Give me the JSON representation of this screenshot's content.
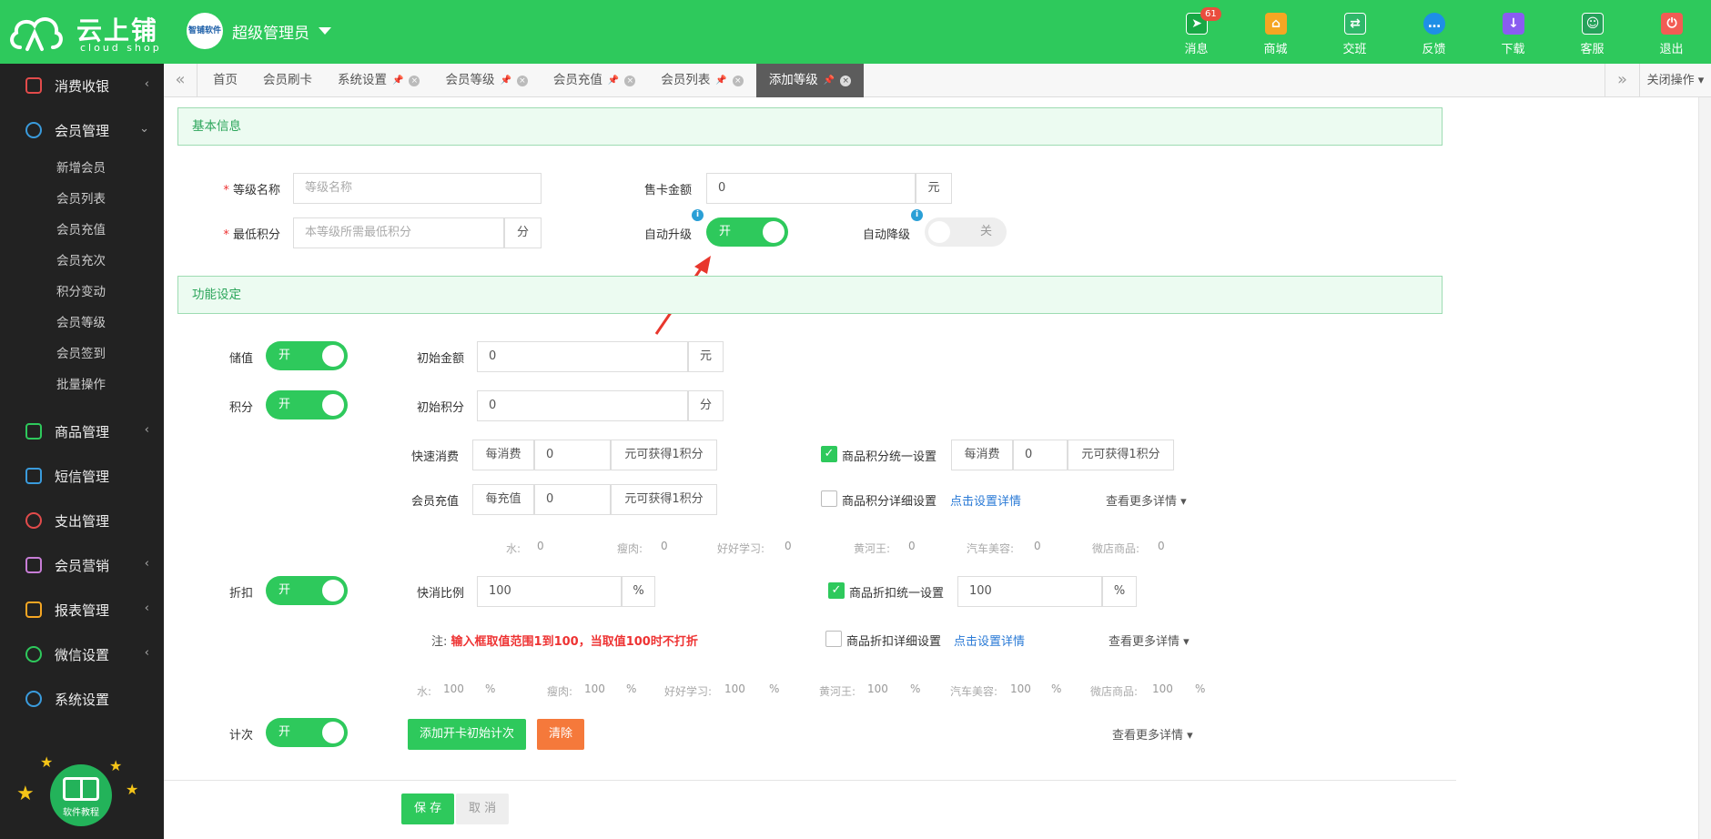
{
  "brand": {
    "name_cn": "云上铺",
    "name_en": "cloud shop"
  },
  "user": {
    "avatar_text": "智铺软件",
    "name": "超级管理员"
  },
  "header_nav": [
    {
      "label": "消息",
      "icon": "paper-plane-icon",
      "color": "#18a845",
      "badge": "61"
    },
    {
      "label": "商城",
      "icon": "store-icon",
      "color": "#f5a623"
    },
    {
      "label": "交班",
      "icon": "exchange-icon",
      "color": "#2fb86a"
    },
    {
      "label": "反馈",
      "icon": "chat-icon",
      "color": "#1e8fe6"
    },
    {
      "label": "下载",
      "icon": "download-icon",
      "color": "#8a5cf0"
    },
    {
      "label": "客服",
      "icon": "support-icon",
      "color": "#25a25a"
    },
    {
      "label": "退出",
      "icon": "power-icon",
      "color": "#f25c54"
    }
  ],
  "sidebar": {
    "items": [
      {
        "label": "消费收银",
        "icon": "cashier-icon",
        "color": "#e24b4b"
      },
      {
        "label": "会员管理",
        "icon": "member-icon",
        "color": "#3a9bdc"
      },
      {
        "label": "商品管理",
        "icon": "goods-icon",
        "color": "#2ec95c"
      },
      {
        "label": "短信管理",
        "icon": "sms-icon",
        "color": "#3a9bdc"
      },
      {
        "label": "支出管理",
        "icon": "expense-icon",
        "color": "#e24b4b"
      },
      {
        "label": "会员营销",
        "icon": "gift-icon",
        "color": "#c77dd6"
      },
      {
        "label": "报表管理",
        "icon": "report-icon",
        "color": "#f5a623"
      },
      {
        "label": "微信设置",
        "icon": "wechat-icon",
        "color": "#2ec95c"
      },
      {
        "label": "系统设置",
        "icon": "gear-icon",
        "color": "#3a9bdc"
      }
    ],
    "sub_items": [
      "新增会员",
      "会员列表",
      "会员充值",
      "会员充次",
      "积分变动",
      "会员等级",
      "会员签到",
      "批量操作"
    ],
    "tutorial": "软件教程"
  },
  "tabs": [
    {
      "label": "首页"
    },
    {
      "label": "会员刷卡"
    },
    {
      "label": "系统设置"
    },
    {
      "label": "会员等级"
    },
    {
      "label": "会员充值"
    },
    {
      "label": "会员列表"
    },
    {
      "label": "添加等级"
    }
  ],
  "close_ops": "关闭操作",
  "basic": {
    "title": "基本信息",
    "level_name_label": "等级名称",
    "level_name_ph": "等级名称",
    "min_points_label": "最低积分",
    "min_points_ph": "本等级所需最低积分",
    "min_points_unit": "分",
    "card_price_label": "售卡金额",
    "card_price_value": "0",
    "card_price_unit": "元",
    "auto_up_label": "自动升级",
    "auto_up_state": "开",
    "auto_down_label": "自动降级",
    "auto_down_state": "关"
  },
  "func": {
    "title": "功能设定",
    "stored_label": "储值",
    "stored_state": "开",
    "init_amount_label": "初始金额",
    "init_amount_value": "0",
    "init_amount_unit": "元",
    "points_label": "积分",
    "points_state": "开",
    "init_points_label": "初始积分",
    "init_points_value": "0",
    "init_points_unit": "分",
    "quick_label": "快速消费",
    "per_spend": "每消费",
    "quick_value": "0",
    "earn_suffix": "元可获得1积分",
    "recharge_label": "会员充值",
    "per_recharge": "每充值",
    "recharge_value": "0",
    "goods_points_unified": "商品积分统一设置",
    "goods_points_value": "0",
    "goods_points_detail": "商品积分详细设置",
    "click_detail": "点击设置详情",
    "more": "查看更多详情",
    "points_cats": [
      {
        "name": "水:",
        "value": "0"
      },
      {
        "name": "瘦肉:",
        "value": "0"
      },
      {
        "name": "好好学习:",
        "value": "0"
      },
      {
        "name": "黄河王:",
        "value": "0"
      },
      {
        "name": "汽车美容:",
        "value": "0"
      },
      {
        "name": "微店商品:",
        "value": "0"
      }
    ],
    "discount_label": "折扣",
    "discount_state": "开",
    "quick_ratio_label": "快消比例",
    "quick_ratio_value": "100",
    "pct": "%",
    "goods_discount_unified": "商品折扣统一设置",
    "goods_discount_value": "100",
    "goods_discount_detail": "商品折扣详细设置",
    "note_prefix": "注:",
    "note_text": "输入框取值范围1到100，当取值100时不打折",
    "discount_cats": [
      {
        "name": "水:",
        "value": "100"
      },
      {
        "name": "瘦肉:",
        "value": "100"
      },
      {
        "name": "好好学习:",
        "value": "100"
      },
      {
        "name": "黄河王:",
        "value": "100"
      },
      {
        "name": "汽车美容:",
        "value": "100"
      },
      {
        "name": "微店商品:",
        "value": "100"
      }
    ],
    "count_label": "计次",
    "count_state": "开",
    "add_count_btn": "添加开卡初始计次",
    "clear_btn": "清除"
  },
  "actions": {
    "save": "保 存",
    "cancel": "取 消"
  }
}
